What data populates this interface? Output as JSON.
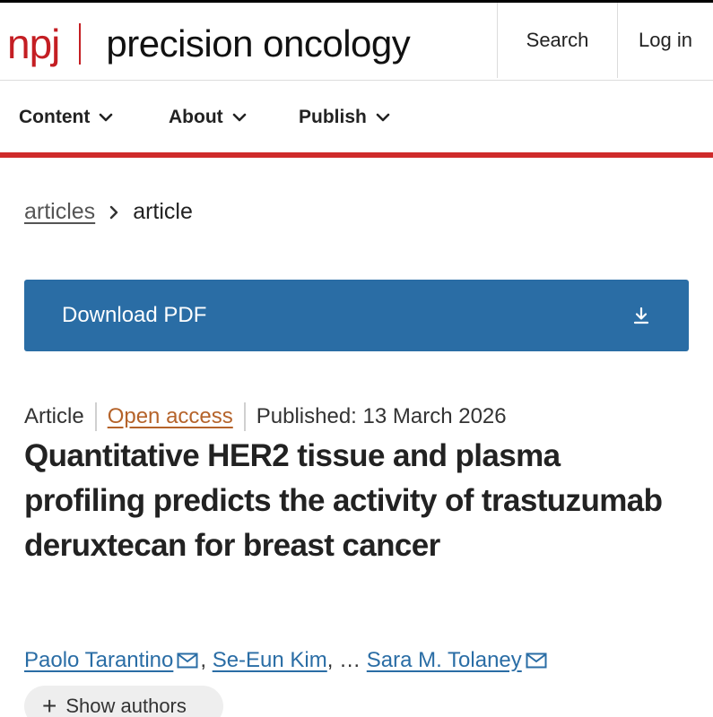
{
  "header": {
    "logo_brand": "npj",
    "logo_name": "precision oncology",
    "search_label": "Search",
    "login_label": "Log in"
  },
  "nav": {
    "items": [
      {
        "label": "Content"
      },
      {
        "label": "About"
      },
      {
        "label": "Publish"
      }
    ]
  },
  "breadcrumb": {
    "parent": "articles",
    "current": "article"
  },
  "download": {
    "label": "Download PDF"
  },
  "article": {
    "type": "Article",
    "access": "Open access",
    "published": "Published: 13 March 2026",
    "title": "Quantitative HER2 tissue and plasma profiling predicts the activity of trastuzumab deruxtecan for breast cancer",
    "authors": [
      "Paolo Tarantino",
      "Se-Eun Kim",
      "Sara M. Tolaney"
    ],
    "ellipsis": "…",
    "show_authors": "Show authors"
  },
  "colors": {
    "brand_red": "#c41e23",
    "nav_rule": "#cf2b2b",
    "download_bg": "#2a6da5",
    "open_access": "#b5632a",
    "author_link": "#2a6da5"
  }
}
